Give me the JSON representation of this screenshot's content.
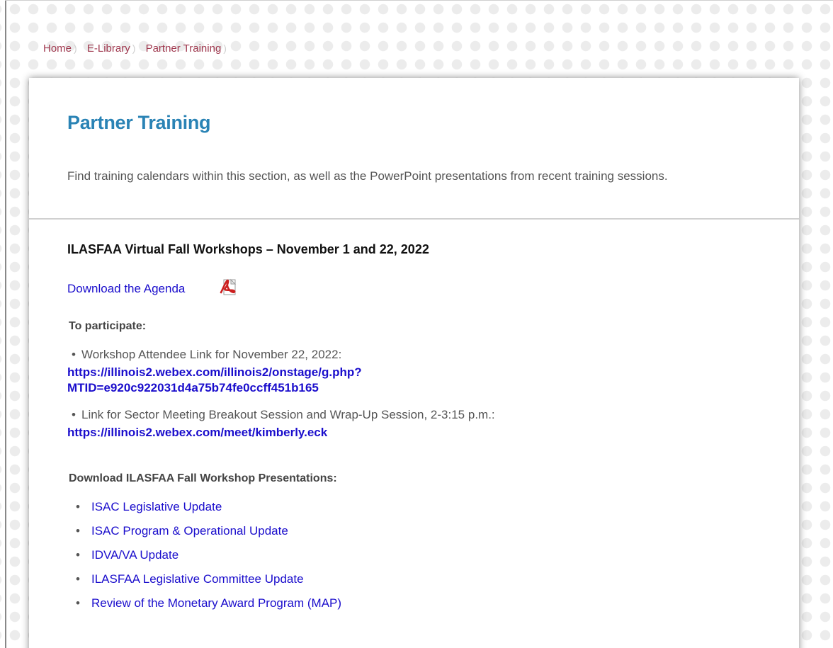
{
  "breadcrumb": {
    "items": [
      {
        "label": "Home"
      },
      {
        "label": "E-Library"
      },
      {
        "label": "Partner Training"
      }
    ],
    "separator": ")"
  },
  "page": {
    "title": "Partner Training",
    "intro": "Find training calendars within this section, as well as the PowerPoint presentations from recent training sessions."
  },
  "section": {
    "heading": "ILASFAA Virtual Fall Workshops – November 1 and 22, 2022",
    "agenda_link": "Download the Agenda",
    "agenda_icon": "pdf-icon",
    "participate_label": "To participate:",
    "participate_items": [
      {
        "text": "Workshop Attendee Link for November 22, 2022:",
        "link_line1": "https://illinois2.webex.com/illinois2/onstage/g.php?",
        "link_line2": "MTID=e920c922031d4a75b74fe0ccff451b165"
      },
      {
        "text": "Link for Sector Meeting Breakout Session and Wrap-Up Session, 2-3:15 p.m.:",
        "link_line1": "https://illinois2.webex.com/meet/kimberly.eck"
      }
    ],
    "presentations_label": "Download ILASFAA Fall Workshop Presentations:",
    "presentations": [
      {
        "label": "ISAC Legislative Update"
      },
      {
        "label": "ISAC Program & Operational Update"
      },
      {
        "label": "IDVA/VA Update"
      },
      {
        "label": "ILASFAA Legislative Committee Update"
      },
      {
        "label": "Review of the Monetary Award Program (MAP)"
      }
    ],
    "bullet": "•"
  },
  "colors": {
    "title": "#2a83b5",
    "link": "#1a0dcc",
    "breadcrumb": "#a0394f",
    "body_text": "#555555",
    "pdf_red": "#cc1f1f"
  }
}
